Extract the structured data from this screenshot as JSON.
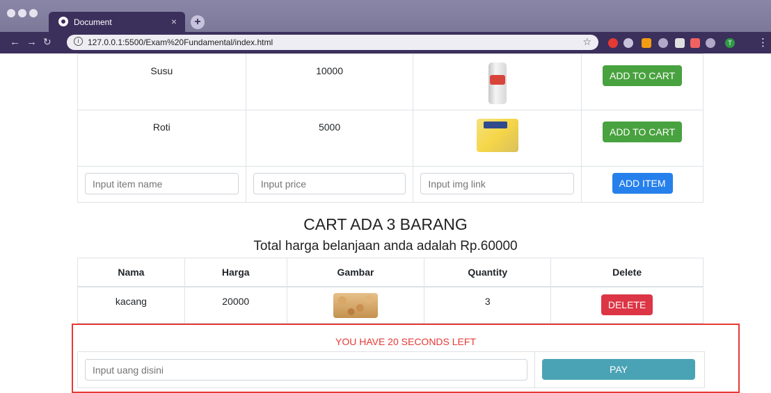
{
  "browser": {
    "tab_title": "Document",
    "tab_close": "×",
    "new_tab": "+",
    "url": "127.0.0.1:5500/Exam%20Fundamental/index.html",
    "profile_initial": "T"
  },
  "products": [
    {
      "name": "Susu",
      "price": "10000",
      "image": "milk-can",
      "button": "ADD TO CART"
    },
    {
      "name": "Roti",
      "price": "5000",
      "image": "bread-pack",
      "button": "ADD TO CART"
    }
  ],
  "add_form": {
    "name_placeholder": "Input item name",
    "price_placeholder": "Input price",
    "img_placeholder": "Input img link",
    "button": "ADD ITEM"
  },
  "cart": {
    "heading": "CART ADA 3 BARANG",
    "total": "Total harga belanjaan anda adalah Rp.60000",
    "columns": [
      "Nama",
      "Harga",
      "Gambar",
      "Quantity",
      "Delete"
    ],
    "rows": [
      {
        "name": "kacang",
        "price": "20000",
        "image": "peanuts",
        "quantity": "3",
        "button": "DELETE"
      }
    ]
  },
  "payment": {
    "timer": "YOU HAVE 20 SECONDS LEFT",
    "input_placeholder": "Input uang disini",
    "button": "PAY"
  },
  "colors": {
    "add_to_cart": "#48a23f",
    "add_item": "#2680eb",
    "delete": "#dc3545",
    "pay": "#4aa3b5",
    "timer": "#e53935"
  }
}
